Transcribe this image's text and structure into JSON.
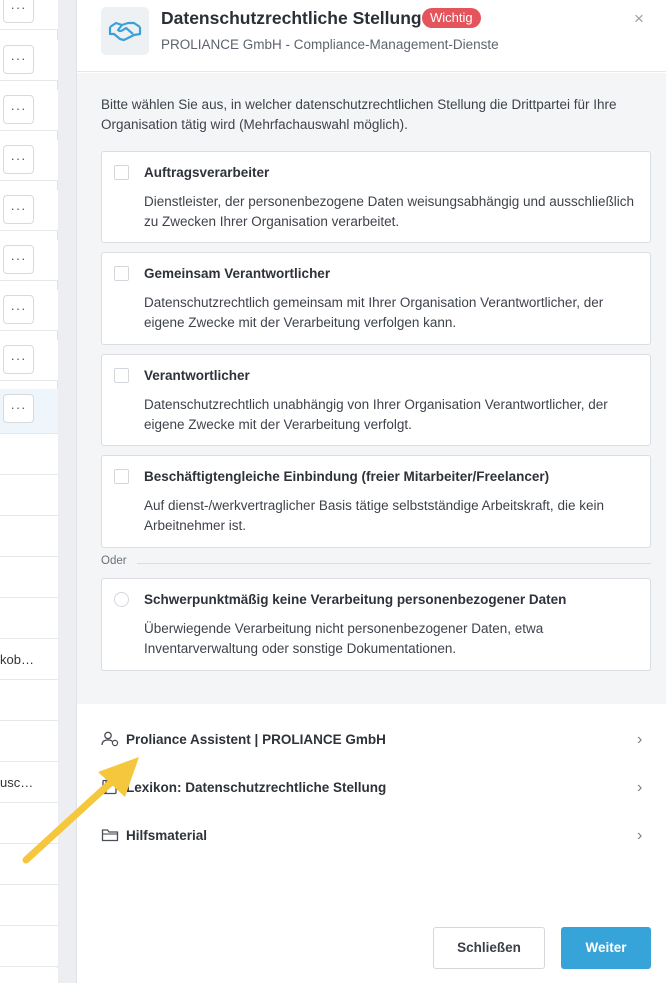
{
  "background_table": {
    "dots_label": "···",
    "truncated_texts": [
      "kob…",
      "usc…"
    ]
  },
  "dialog": {
    "title": "Datenschutzrechtliche Stellung",
    "badge": "Wichtig",
    "subtitle": "PROLIANCE GmbH - Compliance-Management-Dienste",
    "close_label": "×",
    "intro": "Bitte wählen Sie aus, in welcher datenschutzrechtlichen Stellung die Drittpartei für Ihre Organisation tätig wird (Mehrfachauswahl möglich).",
    "options": [
      {
        "title": "Auftragsverarbeiter",
        "desc": "Dienstleister, der personenbezogene Daten weisungsabhängig und ausschließlich zu Zwecken Ihrer Organisation verarbeitet."
      },
      {
        "title": "Gemeinsam Verantwortlicher",
        "desc": "Datenschutzrechtlich gemeinsam mit Ihrer Organisation Verantwortlicher, der eigene Zwecke mit der Verarbeitung verfolgen kann."
      },
      {
        "title": "Verantwortlicher",
        "desc": "Datenschutzrechtlich unabhängig von Ihrer Organisation Verantwortlicher, der eigene Zwecke mit der Verarbeitung verfolgt."
      },
      {
        "title": "Beschäftigtengleiche Einbindung (freier Mitarbeiter/Freelancer)",
        "desc": "Auf dienst-/werkvertraglicher Basis tätige selbstständige Arbeitskraft, die kein Arbeitnehmer ist."
      }
    ],
    "divider_label": "Oder",
    "exclusive_option": {
      "title": "Schwerpunktmäßig keine Verarbeitung personenbezogener Daten",
      "desc": "Überwiegende Verarbeitung nicht personenbezogener Daten, etwa Inventarverwaltung oder sonstige Dokumentationen."
    },
    "links": [
      {
        "label": "Proliance Assistent | PROLIANCE GmbH",
        "icon": "user-settings-icon"
      },
      {
        "label": "Lexikon: Datenschutzrechtliche Stellung",
        "icon": "book-icon"
      },
      {
        "label": "Hilfsmaterial",
        "icon": "folder-icon"
      }
    ],
    "buttons": {
      "close": "Schließen",
      "next": "Weiter"
    }
  },
  "colors": {
    "badge": "#e4545a",
    "primary": "#36a3d9",
    "logo": "#3aa0d8",
    "arrow": "#f5c73c"
  }
}
